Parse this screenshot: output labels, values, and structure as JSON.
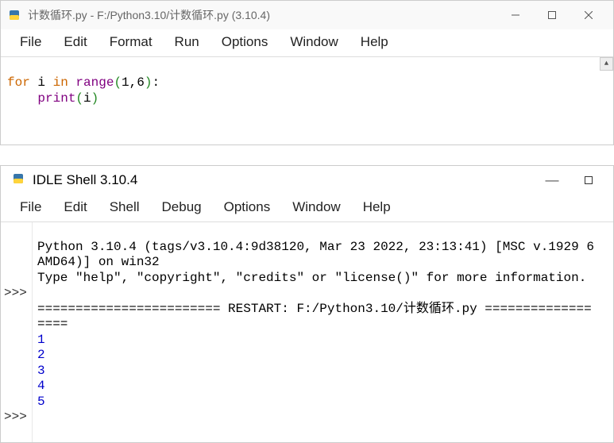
{
  "editorWindow": {
    "title": "计数循环.py - F:/Python3.10/计数循环.py (3.10.4)",
    "menu": [
      "File",
      "Edit",
      "Format",
      "Run",
      "Options",
      "Window",
      "Help"
    ],
    "code": {
      "line1_for": "for",
      "line1_i": " i ",
      "line1_in": "in",
      "line1_range": " range",
      "line1_open": "(",
      "line1_args": "1,6",
      "line1_close": ")",
      "line1_colon": ":",
      "line2_indent": "    ",
      "line2_print": "print",
      "line2_open": "(",
      "line2_arg": "i",
      "line2_close": ")"
    }
  },
  "shellWindow": {
    "title": "IDLE Shell 3.10.4",
    "menu": [
      "File",
      "Edit",
      "Shell",
      "Debug",
      "Options",
      "Window",
      "Help"
    ],
    "winControls": {
      "min": "—",
      "max": "▢"
    },
    "banner1": "Python 3.10.4 (tags/v3.10.4:9d38120, Mar 23 2022, 23:13:41) [MSC v.1929 6",
    "banner2": "AMD64)] on win32",
    "banner3": "Type \"help\", \"copyright\", \"credits\" or \"license()\" for more information.",
    "restartLine": "======================== RESTART: F:/Python3.10/计数循环.py ==============",
    "restartTail": "====",
    "outputs": [
      "1",
      "2",
      "3",
      "4",
      "5"
    ],
    "prompt": ">>>"
  }
}
